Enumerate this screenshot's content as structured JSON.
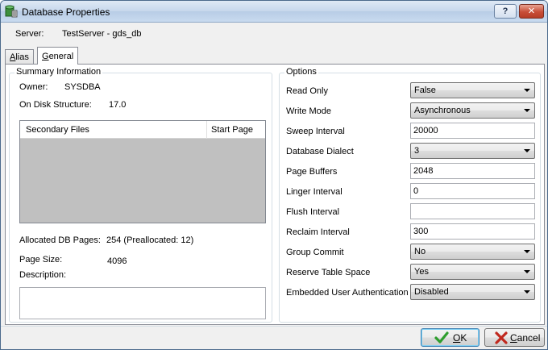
{
  "window": {
    "title": "Database Properties",
    "help_label": "?",
    "close_label": "✕"
  },
  "server": {
    "label": "Server:",
    "value": "TestServer - gds_db"
  },
  "tabs": [
    {
      "label": "Alias",
      "mnemonic": "A",
      "rest": "lias",
      "active": false
    },
    {
      "label": "General",
      "mnemonic": "G",
      "rest": "eneral",
      "active": true
    }
  ],
  "summary": {
    "legend": "Summary Information",
    "owner_label": "Owner:",
    "owner_value": "SYSDBA",
    "ods_label": "On Disk Structure:",
    "ods_value": "17.0",
    "grid_columns": [
      "Secondary Files",
      "Start Page"
    ],
    "alloc_label": "Allocated DB Pages:",
    "alloc_value": "254 (Preallocated: 12)",
    "pagesize_label": "Page Size:",
    "pagesize_value": "4096",
    "description_label": "Description:",
    "description_value": ""
  },
  "options": {
    "legend": "Options",
    "fields": [
      {
        "label": "Read Only",
        "type": "combo",
        "value": "False"
      },
      {
        "label": "Write Mode",
        "type": "combo",
        "value": "Asynchronous"
      },
      {
        "label": "Sweep Interval",
        "type": "edit",
        "value": "20000"
      },
      {
        "label": "Database Dialect",
        "type": "combo",
        "value": "3"
      },
      {
        "label": "Page Buffers",
        "type": "edit",
        "value": "2048"
      },
      {
        "label": "Linger Interval",
        "type": "edit",
        "value": "0"
      },
      {
        "label": "Flush Interval",
        "type": "edit",
        "value": ""
      },
      {
        "label": "Reclaim Interval",
        "type": "edit",
        "value": "300"
      },
      {
        "label": "Group Commit",
        "type": "combo",
        "value": "No"
      },
      {
        "label": "Reserve Table Space",
        "type": "combo",
        "value": "Yes"
      },
      {
        "label": "Embedded User Authentication",
        "type": "combo",
        "value": "Disabled"
      }
    ]
  },
  "buttons": {
    "ok_label": "OK",
    "ok_mnemonic": "O",
    "ok_rest": "K",
    "cancel_label": "Cancel",
    "cancel_mnemonic": "C",
    "cancel_rest": "ancel"
  },
  "colors": {
    "ok_icon": "#2e9e2e",
    "cancel_icon": "#c0281e",
    "grid_empty": "#c0c0c0"
  }
}
